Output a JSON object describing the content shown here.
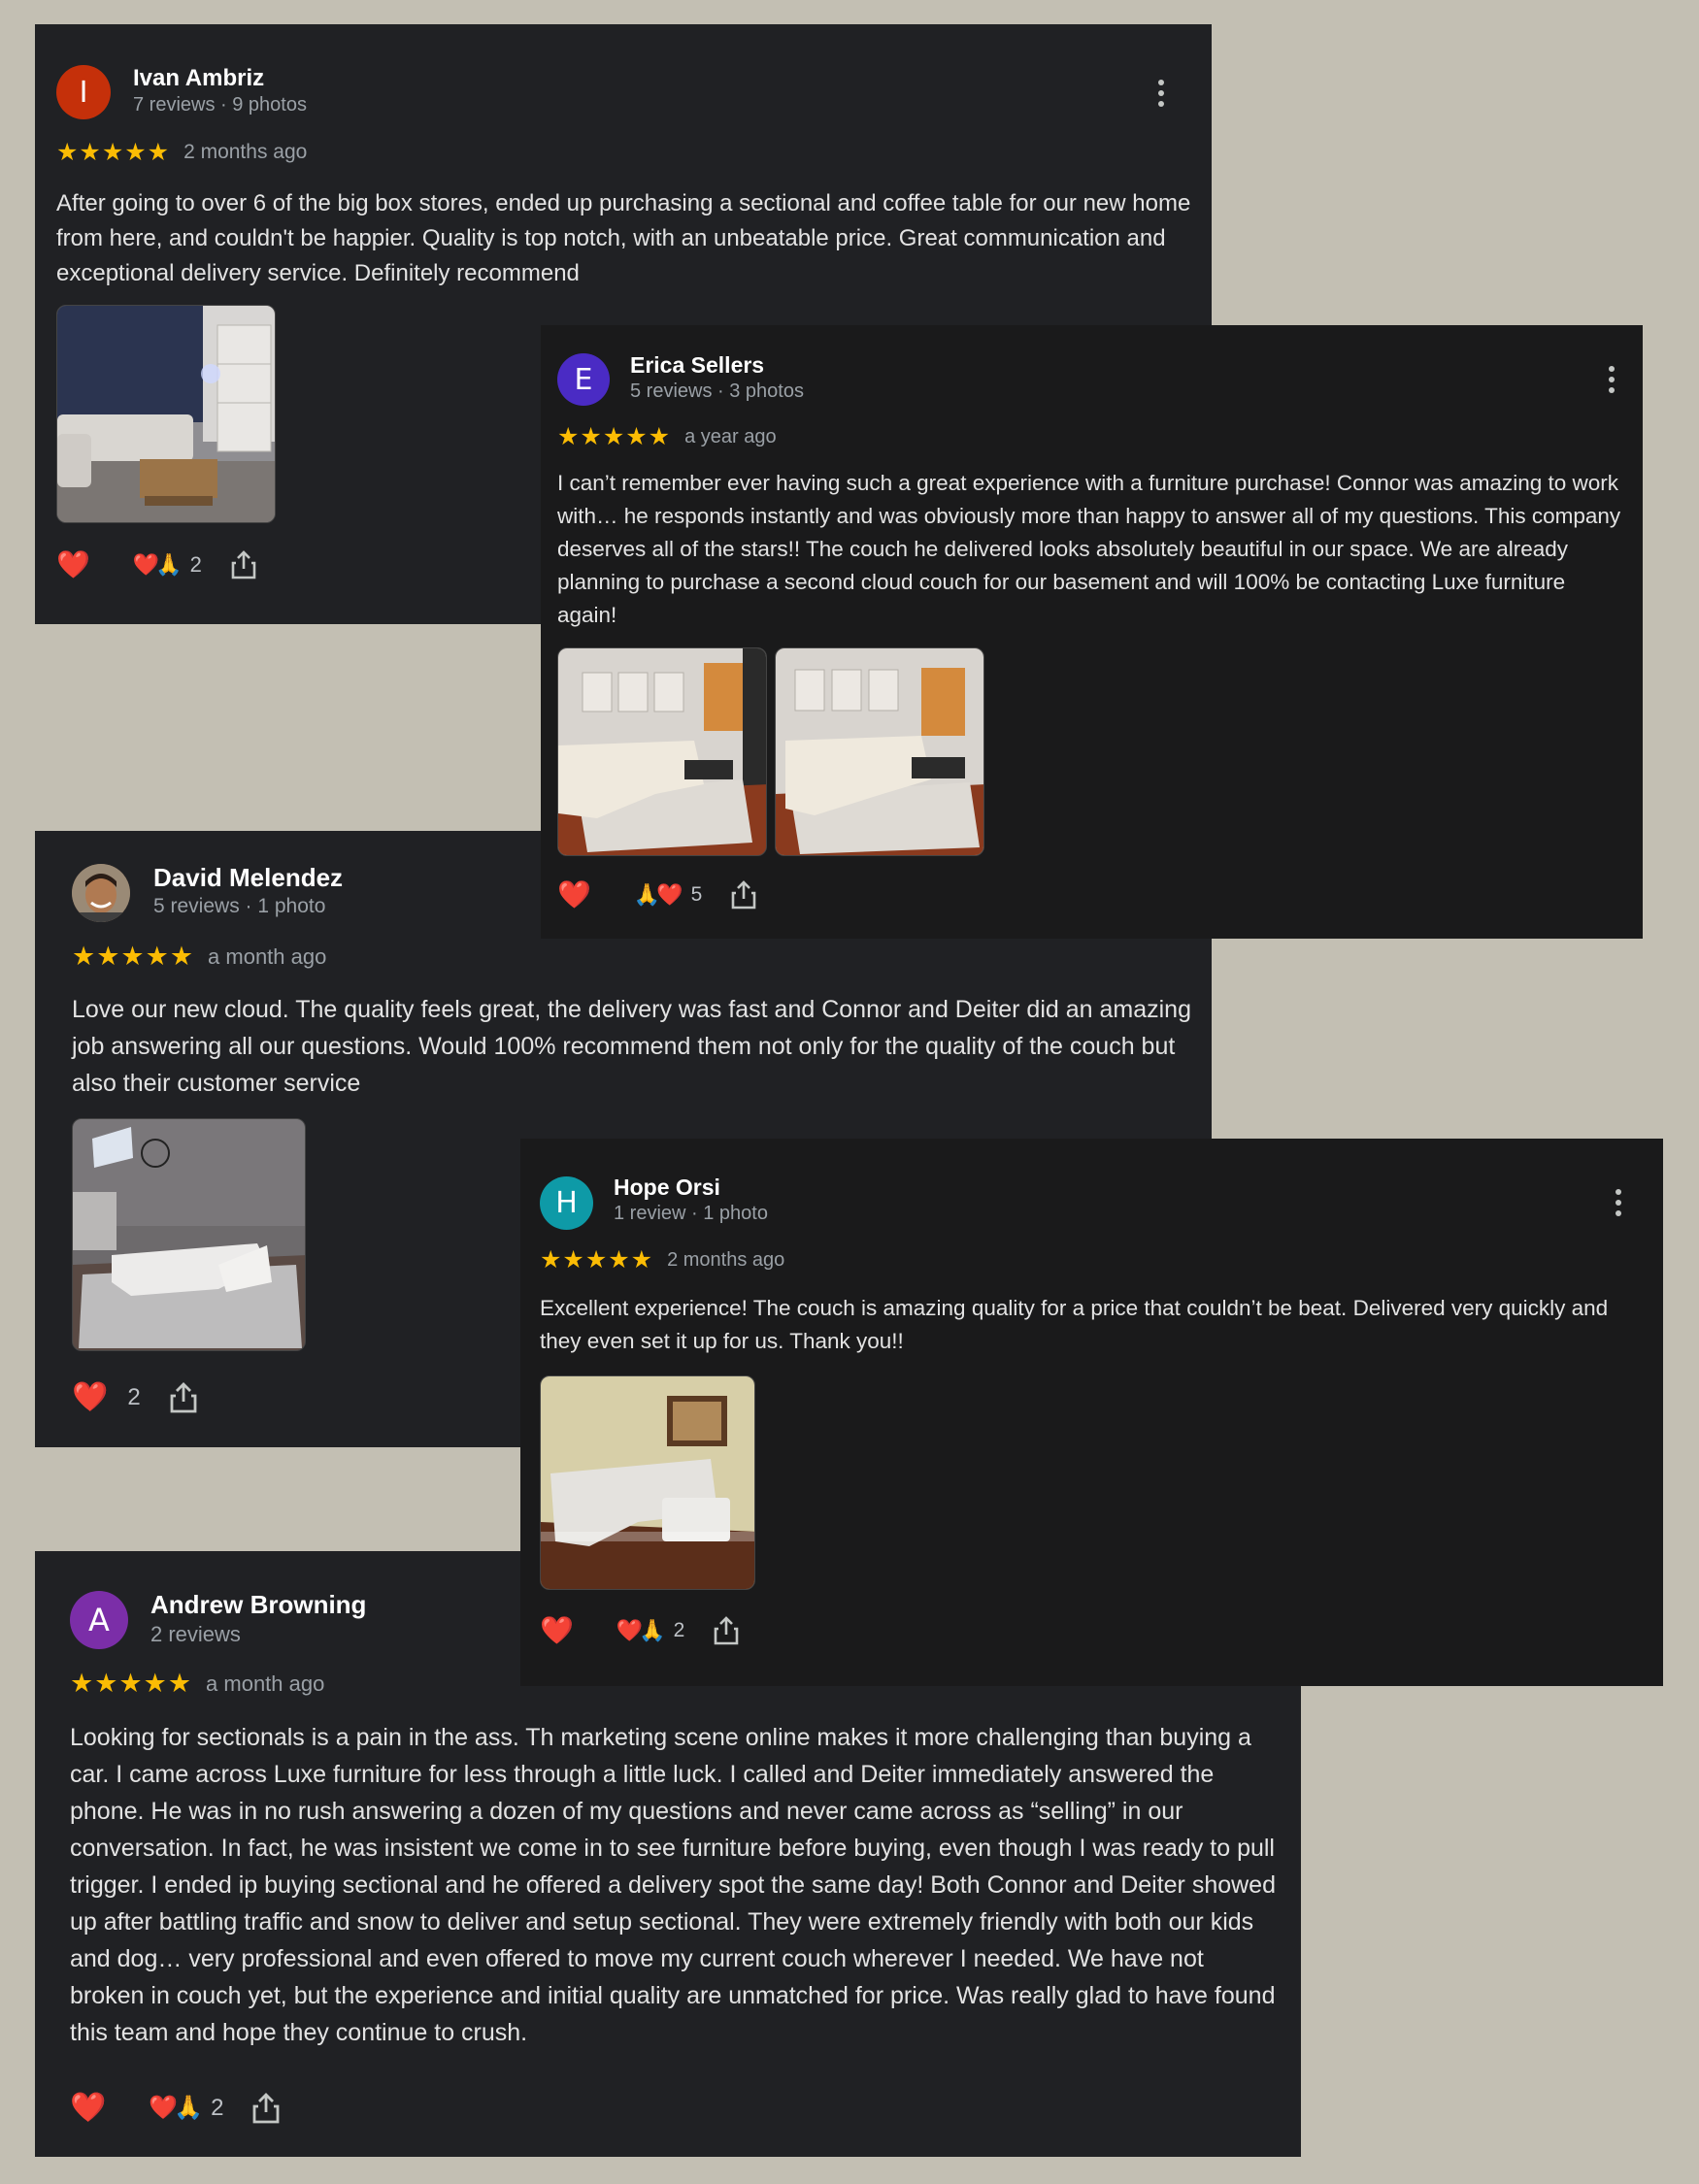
{
  "reviews": [
    {
      "name": "Ivan Ambriz",
      "avatar_letter": "I",
      "avatar_color": "#c5300a",
      "meta": "7 reviews · 9 photos",
      "stars": "★★★★★",
      "rating": 5,
      "date": "2 months ago",
      "text": "After going to over 6 of the big box stores, ended up purchasing a sectional and coffee table for our new home from here, and couldn't be happier. Quality is top notch, with an unbeatable price. Great communication and exceptional delivery service. Definitely recommend",
      "reactions": {
        "heart": "❤️",
        "emoji": "❤️🙏",
        "count": "2"
      }
    },
    {
      "name": "Erica Sellers",
      "avatar_letter": "E",
      "avatar_color": "#4a2bc4",
      "meta": "5 reviews · 3 photos",
      "stars": "★★★★★",
      "rating": 5,
      "date": "a year ago",
      "text": "I can’t remember ever having such a great experience with a furniture purchase! Connor was amazing to work with… he responds instantly and was obviously more than happy to answer all of my questions. This company deserves all of the stars!! The couch he delivered looks absolutely beautiful in our space. We are already planning to purchase a second cloud couch for our basement and will 100% be contacting Luxe furniture again!",
      "reactions": {
        "heart": "❤️",
        "emoji": "🙏❤️",
        "count": "5"
      }
    },
    {
      "name": "David Melendez",
      "meta": "5 reviews · 1 photo",
      "stars": "★★★★★",
      "rating": 5,
      "date": "a month ago",
      "text": "Love our new cloud. The quality feels great, the delivery was fast and Connor and Deiter did an amazing job answering all our questions. Would 100% recommend them not only for the quality of the couch but also their customer service",
      "reactions": {
        "heart": "❤️",
        "count": "2"
      }
    },
    {
      "name": "Hope Orsi",
      "avatar_letter": "H",
      "avatar_color": "#0e9aa7",
      "meta": "1 review · 1 photo",
      "stars": "★★★★★",
      "rating": 5,
      "date": "2 months ago",
      "text": "Excellent experience! The couch is amazing quality for a price that couldn’t be beat. Delivered very quickly and they even set it up for us. Thank you!!",
      "reactions": {
        "heart": "❤️",
        "emoji": "❤️🙏",
        "count": "2"
      }
    },
    {
      "name": "Andrew Browning",
      "avatar_letter": "A",
      "avatar_color": "#7b2ea8",
      "meta": "2 reviews",
      "stars": "★★★★★",
      "rating": 5,
      "date": "a month ago",
      "text": "Looking for sectionals is a pain in the ass. Th marketing scene online makes it more challenging than buying a car. I came across Luxe furniture for less through a little luck. I called and Deiter immediately answered the phone. He was in no rush answering a dozen of my questions and never came across as “selling” in our conversation. In fact, he was insistent we come in to see furniture before buying, even though I was ready to pull trigger. I ended ip buying sectional and he offered a delivery spot the same day! Both Connor and Deiter showed up after battling traffic and snow to deliver and setup sectional. They were extremely friendly with both our kids and dog… very professional and even offered to move my current couch wherever I needed. We have not broken in couch yet, but the experience and initial quality are unmatched for price. Was really glad to have found this team and hope they continue to crush.",
      "reactions": {
        "heart": "❤️",
        "emoji": "❤️🙏",
        "count": "2"
      }
    }
  ]
}
